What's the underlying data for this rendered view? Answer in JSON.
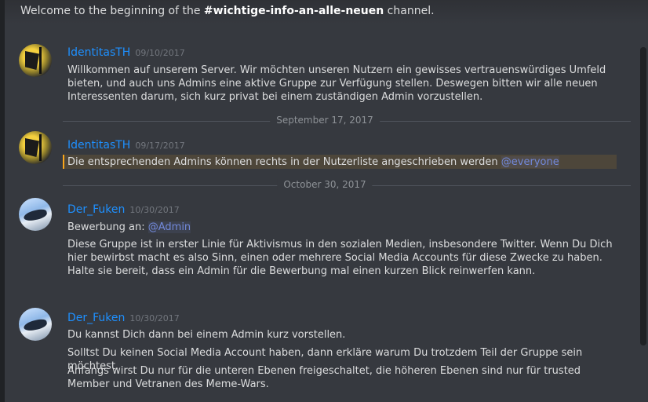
{
  "welcome": {
    "prefix": "Welcome to the beginning of the ",
    "channel": "#wichtige-info-an-alle-neuen",
    "suffix": " channel."
  },
  "messages": [
    {
      "author": "IdentitasTH",
      "timestamp": "09/10/2017",
      "avatar": "flag-avatar",
      "text": "Willkommen auf unserem Server. Wir möchten unseren Nutzern ein gewisses vertrauenswürdiges Umfeld bieten, und auch uns Admins eine aktive Gruppe zur Verfügung stellen. Deswegen bitten wir alle neuen Interessenten darum, sich kurz privat bei einem zuständigen Admin vorzustellen."
    },
    {
      "author": "IdentitasTH",
      "timestamp": "09/17/2017",
      "avatar": "flag-avatar",
      "text": "Die entsprechenden Admins können rechts in der Nutzerliste angeschrieben werden ",
      "mention": "@everyone"
    },
    {
      "author": "Der_Fuken",
      "timestamp": "10/30/2017",
      "avatar": "bird-avatar",
      "line1_prefix": "Bewerbung an: ",
      "line1_mention": "@Admin",
      "text": "Diese Gruppe ist in erster Linie für Aktivismus in den sozialen Medien, insbesondere Twitter. Wenn Du Dich hier bewirbst macht es also Sinn, einen oder mehrere Social Media Accounts für diese Zwecke zu haben. Halte sie bereit, dass ein Admin für die Bewerbung mal einen kurzen Blick reinwerfen kann."
    },
    {
      "author": "Der_Fuken",
      "timestamp": "10/30/2017",
      "avatar": "bird-avatar",
      "line1": "Du kannst Dich dann bei einem Admin kurz vorstellen.",
      "line2": "Solltst Du keinen Social Media Account haben, dann erkläre warum Du trotzdem Teil der Gruppe sein möchtest.",
      "line3": "Anfangs wirst Du nur für die unteren Ebenen freigeschaltet, die höheren Ebenen sind nur für trusted Member und Vetranen des Meme-Wars."
    }
  ],
  "dividers": {
    "first": "September 17, 2017",
    "second": "October 30, 2017"
  },
  "colors": {
    "background": "#36393f",
    "author": "#1e90ff",
    "mention": "#7289da",
    "highlight_bar": "#faa61a"
  }
}
